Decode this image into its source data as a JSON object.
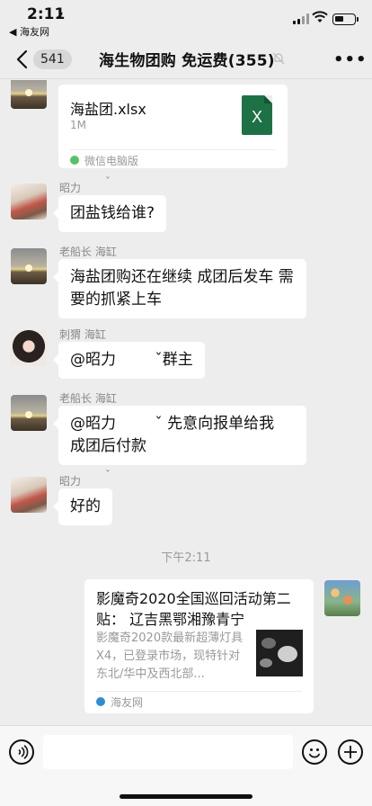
{
  "status_bar": {
    "time": "2:11",
    "back_app": "◀ 海友网"
  },
  "nav": {
    "unread_count": "541",
    "title": "海生物团购  免运费(355)",
    "more_glyph": "•••"
  },
  "messages": [
    {
      "type": "file",
      "sender": "",
      "file_name": "海盐团.xlsx",
      "file_size": "1M",
      "source": "微信电脑版"
    },
    {
      "type": "text",
      "sender": "昭力",
      "sender_suffix": "ˇ",
      "text": "团盐钱给谁?"
    },
    {
      "type": "text",
      "sender": "老船长 海缸",
      "text": "海盐团购还在继续 成团后发车 需要的抓紧上车"
    },
    {
      "type": "text",
      "sender": "刺猬 海缸",
      "text": "@昭力        ˇ群主"
    },
    {
      "type": "text",
      "sender": "老船长 海缸",
      "text": "@昭力        ˇ 先意向报单给我  成团后付款"
    },
    {
      "type": "text",
      "sender": "昭力",
      "sender_suffix": "ˇ",
      "text": "好的"
    }
  ],
  "time_divider": "下午2:11",
  "link_card": {
    "title": "影魔奇2020全国巡回活动第二贴： 辽吉黑鄂湘豫青宁",
    "description": "影魔奇2020款最新超薄灯具X4，已登录市场，现特针对东北/华中及西北部...",
    "source": "海友网"
  },
  "colors": {
    "background": "#ededed",
    "bubble": "#ffffff",
    "excel_green": "#1e7145",
    "meta_gray": "#999999"
  }
}
